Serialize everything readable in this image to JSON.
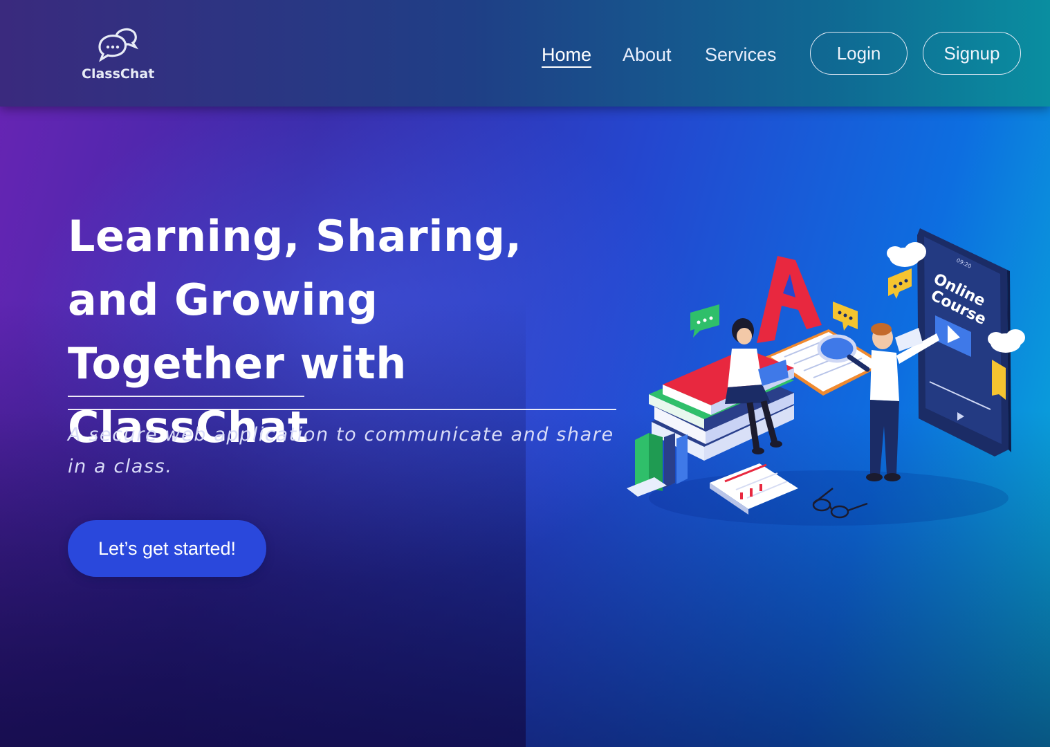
{
  "header": {
    "logo_text": "ClassChat",
    "nav": {
      "home": "Home",
      "about": "About",
      "services": "Services"
    },
    "login_label": "Login",
    "signup_label": "Signup"
  },
  "hero": {
    "title": "Learning, Sharing, and Growing Together with ClassChat",
    "subtitle": "A secure web application to communicate and share in a class.",
    "cta_label": "Let’s get started!"
  },
  "illustration": {
    "letter": "A",
    "phone_text_line1": "Online",
    "phone_text_line2": "Course",
    "phone_time": "09:20"
  },
  "colors": {
    "cta_background": "#2a48dc",
    "accent_red": "#e8283f",
    "accent_yellow": "#f5c430",
    "accent_green": "#2fbf6a"
  }
}
